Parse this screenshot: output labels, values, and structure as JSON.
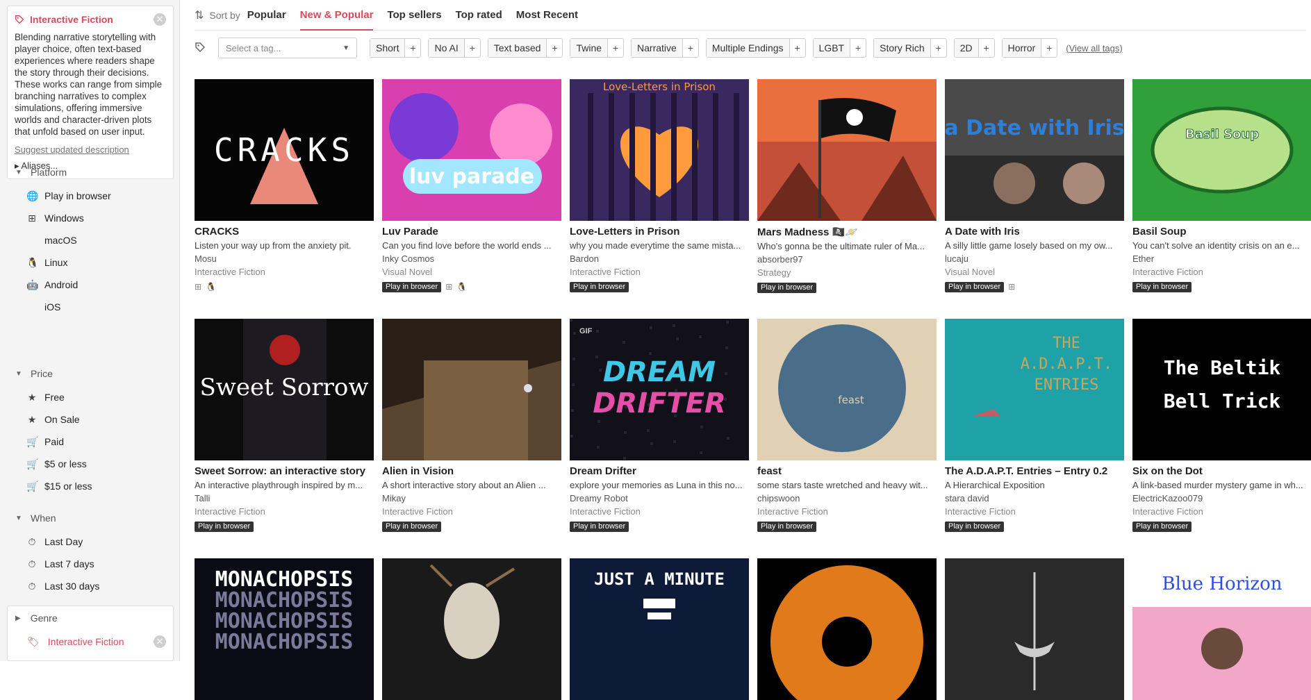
{
  "tag_card": {
    "title": "Interactive Fiction",
    "description": "Blending narrative storytelling with player choice, often text-based experiences where readers shape the story through their decisions. These works can range from simple branching narratives to complex simulations, offering immersive worlds and character-driven plots that unfold based on user input.",
    "suggest_link": "Suggest updated description",
    "aliases": "Aliases..."
  },
  "sidebar": {
    "platform": {
      "label": "Platform",
      "items": [
        "Play in browser",
        "Windows",
        "macOS",
        "Linux",
        "Android",
        "iOS"
      ]
    },
    "price": {
      "label": "Price",
      "items": [
        "Free",
        "On Sale",
        "Paid",
        "$5 or less",
        "$15 or less"
      ]
    },
    "when": {
      "label": "When",
      "items": [
        "Last Day",
        "Last 7 days",
        "Last 30 days"
      ]
    },
    "genre": {
      "label": "Genre",
      "selected": "Interactive Fiction"
    }
  },
  "sort": {
    "label": "Sort by",
    "options": [
      "Popular",
      "New & Popular",
      "Top sellers",
      "Top rated",
      "Most Recent"
    ],
    "active": "New & Popular"
  },
  "tags": {
    "placeholder": "Select a tag...",
    "chips": [
      "Short",
      "No AI",
      "Text based",
      "Twine",
      "Narrative",
      "Multiple Endings",
      "LGBT",
      "Story Rich",
      "2D",
      "Horror"
    ],
    "view_all": "(View all tags)"
  },
  "games": [
    {
      "title": "CRACKS",
      "desc": "Listen your way up from the anxiety pit.",
      "author": "Mosu",
      "genre": "Interactive Fiction",
      "platforms": [
        "windows",
        "linux",
        "mac"
      ],
      "browser": false,
      "thumb_text": "CRACKS"
    },
    {
      "title": "Luv Parade",
      "desc": "Can you find love before the world ends ...",
      "author": "Inky Cosmos",
      "genre": "Visual Novel",
      "platforms": [
        "windows",
        "linux"
      ],
      "browser": true,
      "thumb_text": "luv parade"
    },
    {
      "title": "Love-Letters in Prison",
      "desc": "why you made everytime the same mista...",
      "author": "Bardon",
      "genre": "Interactive Fiction",
      "platforms": [],
      "browser": true,
      "thumb_text": "Love-Letters in Prison"
    },
    {
      "title": "Mars Madness 🏴‍☠️🪐",
      "desc": "Who's gonna be the ultimate ruler of Ma...",
      "author": "absorber97",
      "genre": "Strategy",
      "platforms": [],
      "browser": true,
      "thumb_text": ""
    },
    {
      "title": "A Date with Iris",
      "desc": "A silly little game losely based on my ow...",
      "author": "lucaju",
      "genre": "Visual Novel",
      "platforms": [
        "windows"
      ],
      "browser": true,
      "thumb_text": "a Date with Iris"
    },
    {
      "title": "Basil Soup",
      "desc": "You can't solve an identity crisis on an e...",
      "author": "Ether",
      "genre": "Interactive Fiction",
      "platforms": [],
      "browser": true,
      "thumb_text": "Basil Soup"
    },
    {
      "title": "Sweet Sorrow: an interactive story",
      "desc": "An interactive playthrough inspired by m...",
      "author": "Talli",
      "genre": "Interactive Fiction",
      "platforms": [],
      "browser": true,
      "thumb_text": "Sweet Sorrow"
    },
    {
      "title": "Alien in Vision",
      "desc": "A short interactive story about an Alien ...",
      "author": "Mikay",
      "genre": "Interactive Fiction",
      "platforms": [],
      "browser": true,
      "thumb_text": ""
    },
    {
      "title": "Dream Drifter",
      "desc": "explore your memories as Luna in this no...",
      "author": "Dreamy Robot",
      "genre": "Interactive Fiction",
      "platforms": [],
      "browser": true,
      "thumb_text": "DREAM DRIFTER",
      "gif": "GIF"
    },
    {
      "title": "feast",
      "desc": "some stars taste wretched and heavy wit...",
      "author": "chipswoon",
      "genre": "Interactive Fiction",
      "platforms": [],
      "browser": true,
      "thumb_text": "feast"
    },
    {
      "title": "The A.D.A.P.T. Entries – Entry 0.2",
      "desc": "A Hierarchical Exposition",
      "author": "stara david",
      "genre": "Interactive Fiction",
      "platforms": [],
      "browser": true,
      "thumb_text": "THE A.D.A.P.T. ENTRIES"
    },
    {
      "title": "Six on the Dot",
      "desc": "A link-based murder mystery game in wh...",
      "author": "ElectricKazoo079",
      "genre": "Interactive Fiction",
      "platforms": [],
      "browser": true,
      "thumb_text": "The Beltik Bell Trick"
    },
    {
      "title": "",
      "thumb_text": "MONACHOPSIS"
    },
    {
      "title": "",
      "thumb_text": ""
    },
    {
      "title": "",
      "thumb_text": "JUST A MINUTE"
    },
    {
      "title": "",
      "thumb_text": ""
    },
    {
      "title": "",
      "thumb_text": ""
    },
    {
      "title": "",
      "thumb_text": "Blue Horizon"
    }
  ],
  "browser_badge": "Play in browser",
  "colors": {
    "accent": "#d94a5c"
  }
}
